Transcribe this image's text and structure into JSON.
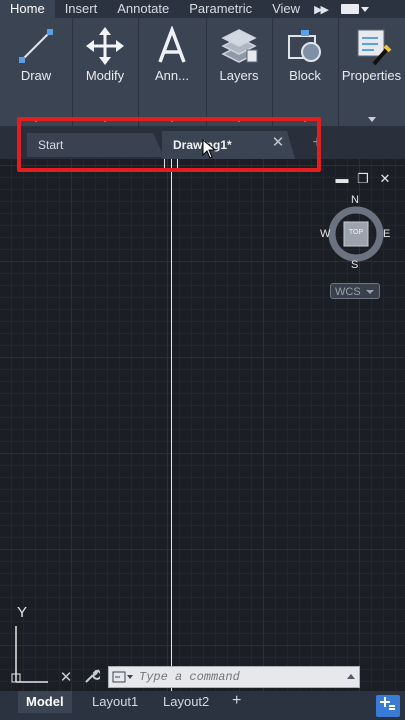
{
  "menu": {
    "tabs": [
      "Home",
      "Insert",
      "Annotate",
      "Parametric",
      "View"
    ],
    "active": "Home",
    "more_icon": "double-chevron-right-icon"
  },
  "ribbon": {
    "panels": [
      {
        "label": "Draw",
        "icon": "line-icon"
      },
      {
        "label": "Modify",
        "icon": "move-arrows-icon"
      },
      {
        "label": "Ann...",
        "icon": "text-a-icon"
      },
      {
        "label": "Layers",
        "icon": "layers-icon"
      },
      {
        "label": "Block",
        "icon": "block-icon"
      },
      {
        "label": "Properties",
        "icon": "properties-icon"
      }
    ]
  },
  "file_tabs": {
    "start": "Start",
    "active": "Drawing1*",
    "close_symbol": "✕",
    "add_symbol": "+"
  },
  "viewport": {
    "minimize": "▬",
    "restore": "❐",
    "close": "✕"
  },
  "viewcube": {
    "north": "N",
    "south": "S",
    "east": "E",
    "west": "W",
    "face": "TOP"
  },
  "wcs": {
    "label": "WCS"
  },
  "ucs": {
    "axis": "Y"
  },
  "command": {
    "placeholder": "Type a command",
    "close_symbol": "✕",
    "customize_icon": "wrench-icon"
  },
  "layout_tabs": {
    "tabs": [
      "Model",
      "Layout1",
      "Layout2"
    ],
    "active": "Model",
    "add_symbol": "+"
  },
  "colors": {
    "highlight": "#e41e1e",
    "ribbon_bg": "#3b4453",
    "canvas_bg": "#1b1e24",
    "accent": "#3a7bd5"
  }
}
